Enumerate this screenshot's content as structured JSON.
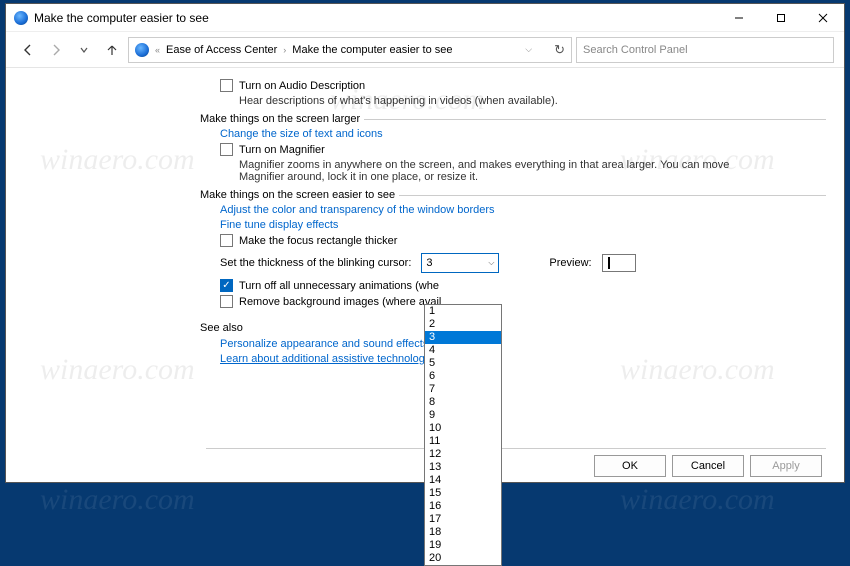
{
  "window": {
    "title": "Make the computer easier to see"
  },
  "nav": {
    "crumb1": "Ease of Access Center",
    "crumb2": "Make the computer easier to see"
  },
  "search": {
    "placeholder": "Search Control Panel"
  },
  "audio": {
    "checkbox": "Turn on Audio Description",
    "desc": "Hear descriptions of what's happening in videos (when available)."
  },
  "larger": {
    "title": "Make things on the screen larger",
    "link": "Change the size of text and icons",
    "magnifier": "Turn on Magnifier",
    "magdesc": "Magnifier zooms in anywhere on the screen, and makes everything in that area larger. You can move Magnifier around, lock it in one place, or resize it."
  },
  "easier": {
    "title": "Make things on the screen easier to see",
    "link1": "Adjust the color and transparency of the window borders",
    "link2": "Fine tune display effects",
    "focus": "Make the focus rectangle thicker",
    "cursorlabel": "Set the thickness of the blinking cursor:",
    "cursorvalue": "3",
    "previewlabel": "Preview:",
    "anim": "Turn off all unnecessary animations (whe",
    "bg": "Remove background images (where avail"
  },
  "dropdown": {
    "options": [
      "1",
      "2",
      "3",
      "4",
      "5",
      "6",
      "7",
      "8",
      "9",
      "10",
      "11",
      "12",
      "13",
      "14",
      "15",
      "16",
      "17",
      "18",
      "19",
      "20"
    ],
    "selected": "3"
  },
  "seealso": {
    "title": "See also",
    "link1": "Personalize appearance and sound effects",
    "link2": "Learn about additional assistive technologie"
  },
  "buttons": {
    "ok": "OK",
    "cancel": "Cancel",
    "apply": "Apply"
  },
  "watermark": "winaero.com"
}
